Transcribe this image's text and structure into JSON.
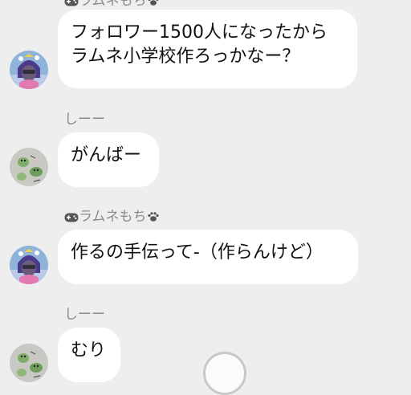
{
  "messages": [
    {
      "sender": "ラムネもち",
      "sender_icons": [
        "gamepad-icon",
        "paw-icon"
      ],
      "avatar": "avatar-ramune",
      "lines": [
        "フォロワー1500人になったから",
        "ラムネ小学校作ろっかなー？"
      ]
    },
    {
      "sender": "しーー",
      "avatar": "avatar-shii",
      "lines": [
        "がんばー"
      ]
    },
    {
      "sender": "ラムネもち",
      "sender_icons": [
        "gamepad-icon",
        "paw-icon"
      ],
      "avatar": "avatar-ramune",
      "lines": [
        "作るの手伝って-（作らんけど）"
      ]
    },
    {
      "sender": "しーー",
      "avatar": "avatar-shii",
      "lines": [
        "むり"
      ]
    }
  ],
  "colors": {
    "background": "#eeeeee",
    "bubble": "#ffffff",
    "sender_text": "#8a8a8a",
    "message_text": "#111111"
  },
  "overlay": {
    "button": "home-button"
  }
}
